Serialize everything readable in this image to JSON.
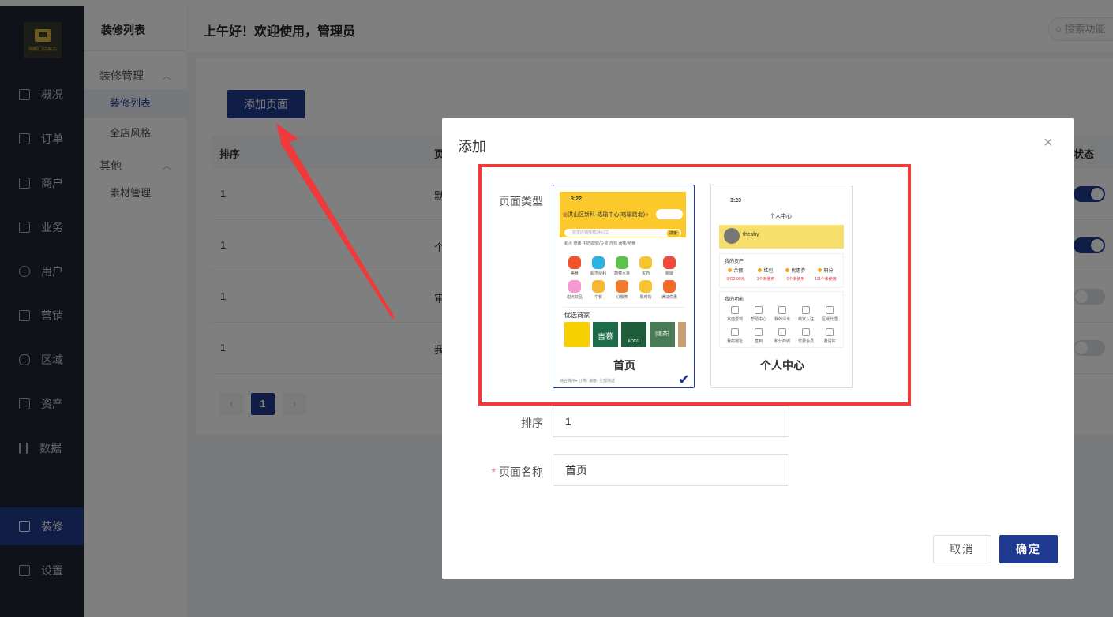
{
  "sidebar": {
    "logo_text": "瑞麟门店展示",
    "items": [
      {
        "label": "概况",
        "icon": "dashboard-icon"
      },
      {
        "label": "订单",
        "icon": "order-icon"
      },
      {
        "label": "商户",
        "icon": "merchant-icon"
      },
      {
        "label": "业务",
        "icon": "business-icon"
      },
      {
        "label": "用户",
        "icon": "user-icon"
      },
      {
        "label": "营销",
        "icon": "marketing-icon"
      },
      {
        "label": "区域",
        "icon": "region-icon"
      },
      {
        "label": "资产",
        "icon": "asset-icon"
      },
      {
        "label": "数据",
        "icon": "chart-icon"
      },
      {
        "label": "装修",
        "icon": "decoration-icon"
      },
      {
        "label": "设置",
        "icon": "settings-icon"
      }
    ]
  },
  "subsidebar": {
    "title": "装修列表",
    "group1": "装修管理",
    "item1": "装修列表",
    "item2": "全店风格",
    "group2": "其他",
    "item3": "素材管理"
  },
  "header": {
    "greeting": "上午好！欢迎使用，管理员",
    "search_placeholder": "搜索功能"
  },
  "page": {
    "add_button": "添加页面",
    "col_sort": "排序",
    "col_page": "页",
    "col_status": "状态",
    "rows": [
      {
        "sort": "1",
        "name": "默",
        "status": "on"
      },
      {
        "sort": "1",
        "name": "个",
        "status": "on"
      },
      {
        "sort": "1",
        "name": "审",
        "status": "off"
      },
      {
        "sort": "1",
        "name": "我",
        "status": "off"
      }
    ],
    "pager_prev": "‹",
    "pager_current": "1",
    "pager_next": "›"
  },
  "modal": {
    "title": "添加",
    "close": "×",
    "page_type_label": "页面类型",
    "card_home": {
      "name": "首页",
      "time": "3:22",
      "location": "◎洪山区新科·珞瑜中心(珞喻路北) ›",
      "search_placeholder": "奶茶店铺推荐24hr23",
      "search_btn": "搜索",
      "tags": "甜点  烧烤  牛奶/酸奶/豆浆  炸鸡  卤味/熟食",
      "grid": [
        "美食",
        "超市便利",
        "蔬菜水果",
        "买药",
        "跑腿",
        "甜点饮品",
        "午餐",
        "订餐券",
        "限时购",
        "满减优惠"
      ],
      "section": "优选商家",
      "tile2": "吉慕",
      "tile3": "KOKO",
      "tile4": "|继茶|",
      "bottom": "综合排序▾      分类›        速度›        全部筛选"
    },
    "card_profile": {
      "name": "个人中心",
      "time": "3:23",
      "header_title": "个人中心",
      "username": "theshy",
      "assets_title": "我的资产",
      "assets": [
        {
          "label": "余额",
          "value": "9422.00元"
        },
        {
          "label": "红包",
          "value": "3个未使用"
        },
        {
          "label": "优惠券",
          "value": "0个未使用"
        },
        {
          "label": "积分",
          "value": "111个未使用"
        }
      ],
      "functions_title": "我的功能",
      "functions": [
        "充值返现",
        "帮助中心",
        "我的评论",
        "商家入驻",
        "区域代理",
        "我的地址",
        "签到",
        "积分商城",
        "付费会员",
        "邀请好"
      ]
    },
    "sort_label": "排序",
    "sort_value": "1",
    "name_label": "页面名称",
    "name_required": "*",
    "name_value": "首页",
    "cancel": "取消",
    "confirm": "确定"
  },
  "colors": {
    "brand": "#1f3a8f",
    "highlight": "#ee3a3a",
    "accent_yellow": "#fbc92b"
  }
}
